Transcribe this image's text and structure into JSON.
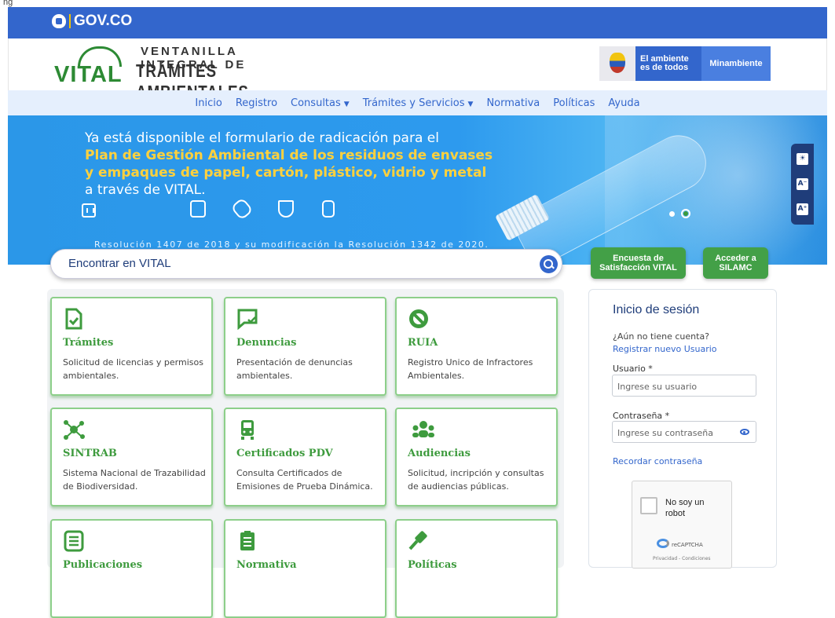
{
  "top_strip": "ng",
  "gov_bar": {
    "logo_text": "GOV.CO"
  },
  "header": {
    "logo_word": "VITAL",
    "title_line1": "VENTANILLA INTEGRAL DE",
    "title_line2": "TRÁMITES AMBIENTALES",
    "badge_line1": "El ambiente",
    "badge_line2": "es de todos",
    "ministry": "Minambiente"
  },
  "nav": {
    "items": [
      "Inicio",
      "Registro",
      "Consultas",
      "Trámites y Servicios",
      "Normativa",
      "Políticas",
      "Ayuda"
    ]
  },
  "banner": {
    "line1": "Ya está disponible el formulario de radicación para el",
    "line2": "Plan de Gestión Ambiental de los residuos de envases",
    "line3": "y empaques de papel, cartón, plástico, vidrio y metal",
    "line4": "a través de VITAL.",
    "resolution": "Resolución 1407 de 2018 y su modificación la Resolución 1342 de 2020."
  },
  "accessibility": {
    "contrast": "☀",
    "decrease": "A⁻",
    "increase": "A⁺"
  },
  "search": {
    "placeholder": "Encontrar en VITAL"
  },
  "buttons": {
    "survey_line1": "Encuesta de",
    "survey_line2": "Satisfacción VITAL",
    "silamc_line1": "Acceder a",
    "silamc_line2": "SILAMC"
  },
  "cards": [
    {
      "title": "Trámites",
      "desc": "Solicitud de licencias y permisos ambientales.",
      "icon": "document-check-icon"
    },
    {
      "title": "Denuncias",
      "desc": "Presentación de denuncias ambientales.",
      "icon": "chat-check-icon"
    },
    {
      "title": "RUIA",
      "desc": "Registro Unico de Infractores Ambientales.",
      "icon": "prohibited-icon"
    },
    {
      "title": "SINTRAB",
      "desc": "Sistema Nacional de Trazabilidad de Biodiversidad.",
      "icon": "network-icon"
    },
    {
      "title": "Certificados PDV",
      "desc": "Consulta Certificados de Emisiones de Prueba Dinámica.",
      "icon": "vehicle-icon"
    },
    {
      "title": "Audiencias",
      "desc": "Solicitud, incripción y consultas de audiencias públicas.",
      "icon": "people-icon"
    },
    {
      "title": "Publicaciones",
      "desc": "",
      "icon": "list-icon"
    },
    {
      "title": "Normativa",
      "desc": "",
      "icon": "clipboard-icon"
    },
    {
      "title": "Políticas",
      "desc": "",
      "icon": "gavel-icon"
    }
  ],
  "login": {
    "title": "Inicio de sesión",
    "no_account": "¿Aún no tiene cuenta?",
    "register_link": "Registrar nuevo Usuario",
    "user_label": "Usuario *",
    "user_placeholder": "Ingrese su usuario",
    "password_label": "Contraseña *",
    "password_placeholder": "Ingrese su contraseña",
    "remember_link": "Recordar contraseña"
  },
  "captcha": {
    "line1": "No soy un",
    "line2": "robot",
    "brand": "reCAPTCHA",
    "privacy": "Privacidad - Condiciones"
  },
  "colors": {
    "gov_blue": "#3366cc",
    "green": "#43a047",
    "banner_blue": "#2d9aee",
    "highlight_yellow": "#ffd13d"
  }
}
